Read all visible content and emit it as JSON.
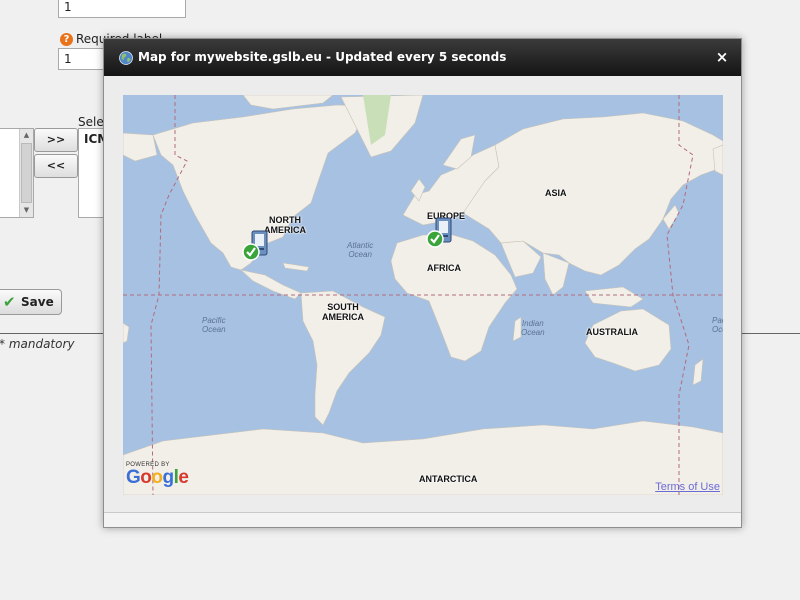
{
  "form": {
    "field1_value": "1",
    "field2_label": "Required label",
    "field2_value": "1",
    "help_icon_glyph": "?",
    "select_label": "Select",
    "move_right_label": ">>",
    "move_left_label": "<<",
    "selected_item": "ICMP",
    "save_label": "Save",
    "mandatory_note": "* mandatory"
  },
  "modal": {
    "title": "Map for mywebsite.gslb.eu - Updated every 5 seconds",
    "close_label": "×",
    "icon": "globe-icon"
  },
  "map": {
    "continents": {
      "north_america": "NORTH\nAMERICA",
      "south_america": "SOUTH\nAMERICA",
      "europe": "EUROPE",
      "africa": "AFRICA",
      "asia": "ASIA",
      "australia": "AUSTRALIA",
      "antarctica": "ANTARCTICA"
    },
    "oceans": {
      "atlantic": "Atlantic\nOcean",
      "pacific_left": "Pacific\nOcean",
      "indian": "Indian\nOcean",
      "pacific_right": "Pacific\nOcean"
    },
    "markers": [
      {
        "name": "server-north-america",
        "status": "ok"
      },
      {
        "name": "server-europe",
        "status": "ok"
      }
    ],
    "powered_by": "POWERED BY",
    "google_letters": [
      "G",
      "o",
      "o",
      "g",
      "l",
      "e"
    ],
    "terms_label": "Terms of Use",
    "colors": {
      "ocean": "#a7c1e2",
      "land": "#f2efe9",
      "border_line": "#b26b7e",
      "check_green": "#3aa33a"
    }
  }
}
